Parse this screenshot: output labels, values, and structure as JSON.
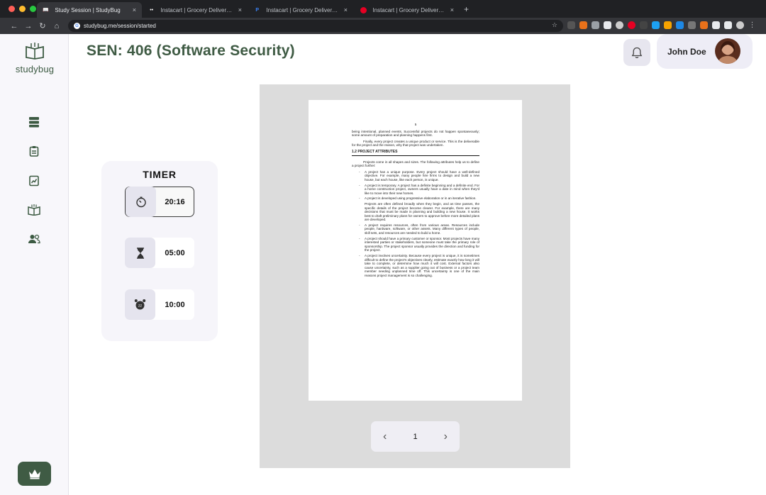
{
  "browser": {
    "tabs": [
      {
        "title": "Study Session | StudyBug",
        "active": true
      },
      {
        "title": "Instacart | Grocery Delivery or Pickup",
        "active": false
      },
      {
        "title": "Instacart | Grocery Delivery or Pickup",
        "active": false
      },
      {
        "title": "Instacart | Grocery Delivery or Pickup",
        "active": false
      }
    ],
    "url": "studybug.me/session/started",
    "close_glyph": "×",
    "newtab_glyph": "+"
  },
  "sidebar": {
    "logo_text": "studybug",
    "items": [
      {
        "icon": "stack-icon"
      },
      {
        "icon": "clipboard-icon"
      },
      {
        "icon": "chart-icon"
      },
      {
        "icon": "open-book-icon"
      },
      {
        "icon": "users-icon"
      }
    ],
    "premium_icon": "crown-icon"
  },
  "header": {
    "title": "SEN: 406 (Software Security)",
    "user_name": "John Doe"
  },
  "timer": {
    "heading": "TIMER",
    "rows": [
      {
        "icon": "stopwatch-icon",
        "value": "20:16",
        "selected": true
      },
      {
        "icon": "hourglass-icon",
        "value": "05:00",
        "selected": false
      },
      {
        "icon": "alarm-icon",
        "value": "10:00",
        "selected": false
      }
    ]
  },
  "document": {
    "page_number": "5",
    "para1": "being intentional, planned events. Successful projects do not happen spontaneously; some amount of preparation and planning happens first.",
    "para2": "Finally, every project creates a unique product or service. This is the deliverable for the project and the reason, why that project was undertaken.",
    "section": "1.2 PROJECT ATTRIBUTES",
    "para3": "Projects come in all shapes and sizes. The following attributes help us to define a project further:",
    "bullets": [
      "A project has a unique purpose. Every project should have a well-defined objective. For example, many people hire firms to design and build a new house, but each house, like each person, is unique.",
      "A project is temporary. A project has a definite beginning and a definite end. For a home construction project, owners usually have a date in mind when they'd like to move into their new homes.",
      "A project is developed using progressive elaboration or in an iterative fashion.",
      "Projects are often defined broadly when they begin, and as time passes, the specific details of the project become clearer. For example, there are many decisions that must be made in planning and building a new house. It works best to draft preliminary plans for owners to approve before more detailed plans are developed.",
      "A project requires resources, often from various areas. Resources include people, hardware, software, or other assets. Many different types of people, skill sets, and resources are needed to build a home.",
      "A project should have a primary customer or sponsor. Most projects have many interested parties or stakeholders, but someone must take the primary role of sponsorship. The project sponsor usually provides the direction and funding for the project.",
      "A project involves uncertainty. Because every project is unique, it is sometimes difficult to define the project's objectives clearly, estimate exactly how long it will take to complete, or determine how much it will cost. External factors also cause uncertainty, such as a supplier going out of business or a project team member needing unplanned time off. This uncertainty is one of the main reasons project management is so challenging."
    ]
  },
  "pager": {
    "current": "1",
    "prev": "‹",
    "next": "›"
  }
}
